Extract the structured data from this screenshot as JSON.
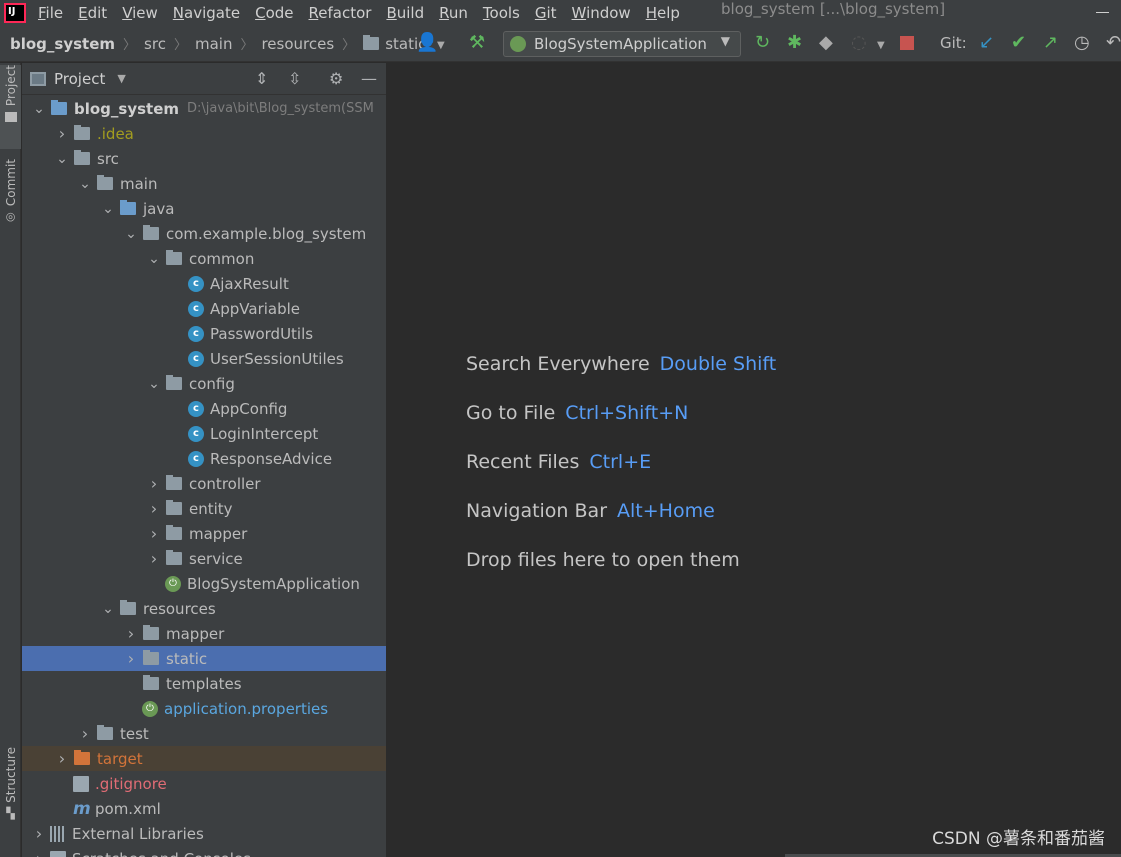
{
  "menubar": {
    "items": [
      {
        "mnemonic": "F",
        "rest": "ile"
      },
      {
        "mnemonic": "E",
        "rest": "dit"
      },
      {
        "mnemonic": "V",
        "rest": "iew"
      },
      {
        "mnemonic": "N",
        "rest": "avigate"
      },
      {
        "mnemonic": "C",
        "rest": "ode"
      },
      {
        "mnemonic": "R",
        "rest": "efactor"
      },
      {
        "mnemonic": "B",
        "rest": "uild"
      },
      {
        "mnemonic": "R",
        "rest": "un"
      },
      {
        "mnemonic": "T",
        "rest": "ools"
      },
      {
        "mnemonic": "G",
        "rest": "it"
      },
      {
        "mnemonic": "W",
        "rest": "indow"
      },
      {
        "mnemonic": "H",
        "rest": "elp"
      }
    ],
    "window_title": "blog_system [...\\blog_system]"
  },
  "navbar": {
    "crumbs": [
      "blog_system",
      "src",
      "main",
      "resources",
      "static"
    ],
    "run_config": "BlogSystemApplication",
    "git_label": "Git:"
  },
  "left_strip": {
    "tabs": [
      "Project",
      "Commit",
      "Structure"
    ]
  },
  "project_panel": {
    "title": "Project",
    "tree": [
      {
        "depth": 0,
        "arrow": "open",
        "icon": "module",
        "name": "blog_system",
        "style": "bold",
        "hint": "D:\\java\\bit\\Blog_system(SSM"
      },
      {
        "depth": 1,
        "arrow": "closed",
        "icon": "folder",
        "name": ".idea",
        "style": "olive"
      },
      {
        "depth": 1,
        "arrow": "open",
        "icon": "folder",
        "name": "src"
      },
      {
        "depth": 2,
        "arrow": "open",
        "icon": "folder",
        "name": "main"
      },
      {
        "depth": 3,
        "arrow": "open",
        "icon": "folder-blue",
        "name": "java"
      },
      {
        "depth": 4,
        "arrow": "open",
        "icon": "package",
        "name": "com.example.blog_system"
      },
      {
        "depth": 5,
        "arrow": "open",
        "icon": "package",
        "name": "common"
      },
      {
        "depth": 6,
        "arrow": "none",
        "icon": "class",
        "name": "AjaxResult"
      },
      {
        "depth": 6,
        "arrow": "none",
        "icon": "class",
        "name": "AppVariable"
      },
      {
        "depth": 6,
        "arrow": "none",
        "icon": "class",
        "name": "PasswordUtils"
      },
      {
        "depth": 6,
        "arrow": "none",
        "icon": "class",
        "name": "UserSessionUtiles"
      },
      {
        "depth": 5,
        "arrow": "open",
        "icon": "package",
        "name": "config"
      },
      {
        "depth": 6,
        "arrow": "none",
        "icon": "class",
        "name": "AppConfig"
      },
      {
        "depth": 6,
        "arrow": "none",
        "icon": "class",
        "name": "LoginIntercept"
      },
      {
        "depth": 6,
        "arrow": "none",
        "icon": "class",
        "name": "ResponseAdvice"
      },
      {
        "depth": 5,
        "arrow": "closed",
        "icon": "package",
        "name": "controller"
      },
      {
        "depth": 5,
        "arrow": "closed",
        "icon": "package",
        "name": "entity"
      },
      {
        "depth": 5,
        "arrow": "closed",
        "icon": "package",
        "name": "mapper"
      },
      {
        "depth": 5,
        "arrow": "closed",
        "icon": "package",
        "name": "service"
      },
      {
        "depth": 5,
        "arrow": "none",
        "icon": "spring",
        "name": "BlogSystemApplication"
      },
      {
        "depth": 3,
        "arrow": "open",
        "icon": "folder-res",
        "name": "resources"
      },
      {
        "depth": 4,
        "arrow": "closed",
        "icon": "folder",
        "name": "mapper"
      },
      {
        "depth": 4,
        "arrow": "closed",
        "icon": "folder",
        "name": "static",
        "selected": true
      },
      {
        "depth": 4,
        "arrow": "none",
        "icon": "folder",
        "name": "templates"
      },
      {
        "depth": 4,
        "arrow": "none",
        "icon": "spring",
        "name": "application.properties",
        "style": "link"
      },
      {
        "depth": 2,
        "arrow": "closed",
        "icon": "folder",
        "name": "test"
      },
      {
        "depth": 1,
        "arrow": "closed",
        "icon": "folder-orange",
        "name": "target",
        "style": "orange",
        "excluded": true
      },
      {
        "depth": 1,
        "arrow": "none",
        "icon": "file",
        "name": ".gitignore",
        "style": "red"
      },
      {
        "depth": 1,
        "arrow": "none",
        "icon": "maven",
        "name": "pom.xml"
      },
      {
        "depth": 0,
        "arrow": "closed",
        "icon": "library",
        "name": "External Libraries"
      },
      {
        "depth": 0,
        "arrow": "closed",
        "icon": "file",
        "name": "Scratches and Consoles"
      }
    ]
  },
  "editor": {
    "hints": [
      {
        "label": "Search Everywhere",
        "key": "Double Shift"
      },
      {
        "label": "Go to File",
        "key": "Ctrl+Shift+N"
      },
      {
        "label": "Recent Files",
        "key": "Ctrl+E"
      },
      {
        "label": "Navigation Bar",
        "key": "Alt+Home"
      },
      {
        "label": "Drop files here to open them",
        "key": ""
      }
    ],
    "watermark": "CSDN @薯条和番茄酱"
  },
  "colors": {
    "selection": "#4b6eaf",
    "shortcut": "#589df6",
    "panel_bg": "#3c3f41",
    "editor_bg": "#2b2b2b"
  }
}
